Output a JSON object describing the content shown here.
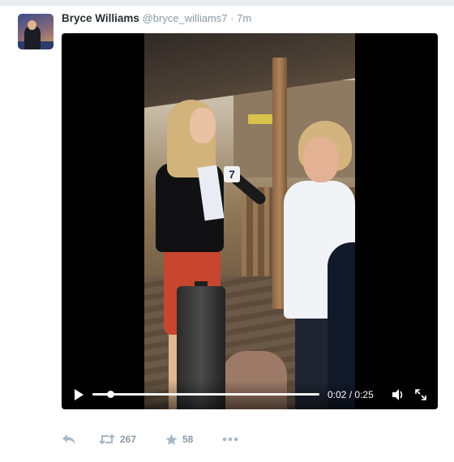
{
  "tweet": {
    "author_name": "Bryce Williams",
    "handle": "@bryce_williams7",
    "separator": "·",
    "time_ago": "7m",
    "avatar_icon": "user-avatar"
  },
  "video": {
    "current_time": "0:02",
    "duration": "0:25",
    "time_separator": "/",
    "progress_fraction": 0.08,
    "mic_flag_label": "7",
    "icons": {
      "play": "play-icon",
      "volume": "volume-icon",
      "fullscreen": "fullscreen-icon"
    }
  },
  "actions": {
    "reply_icon": "reply-icon",
    "retweet_icon": "retweet-icon",
    "retweet_count": "267",
    "favorite_icon": "star-icon",
    "favorite_count": "58",
    "more_icon": "more-icon"
  },
  "colors": {
    "text_primary": "#292f33",
    "text_secondary": "#8899a6",
    "background": "#e9ecee"
  }
}
